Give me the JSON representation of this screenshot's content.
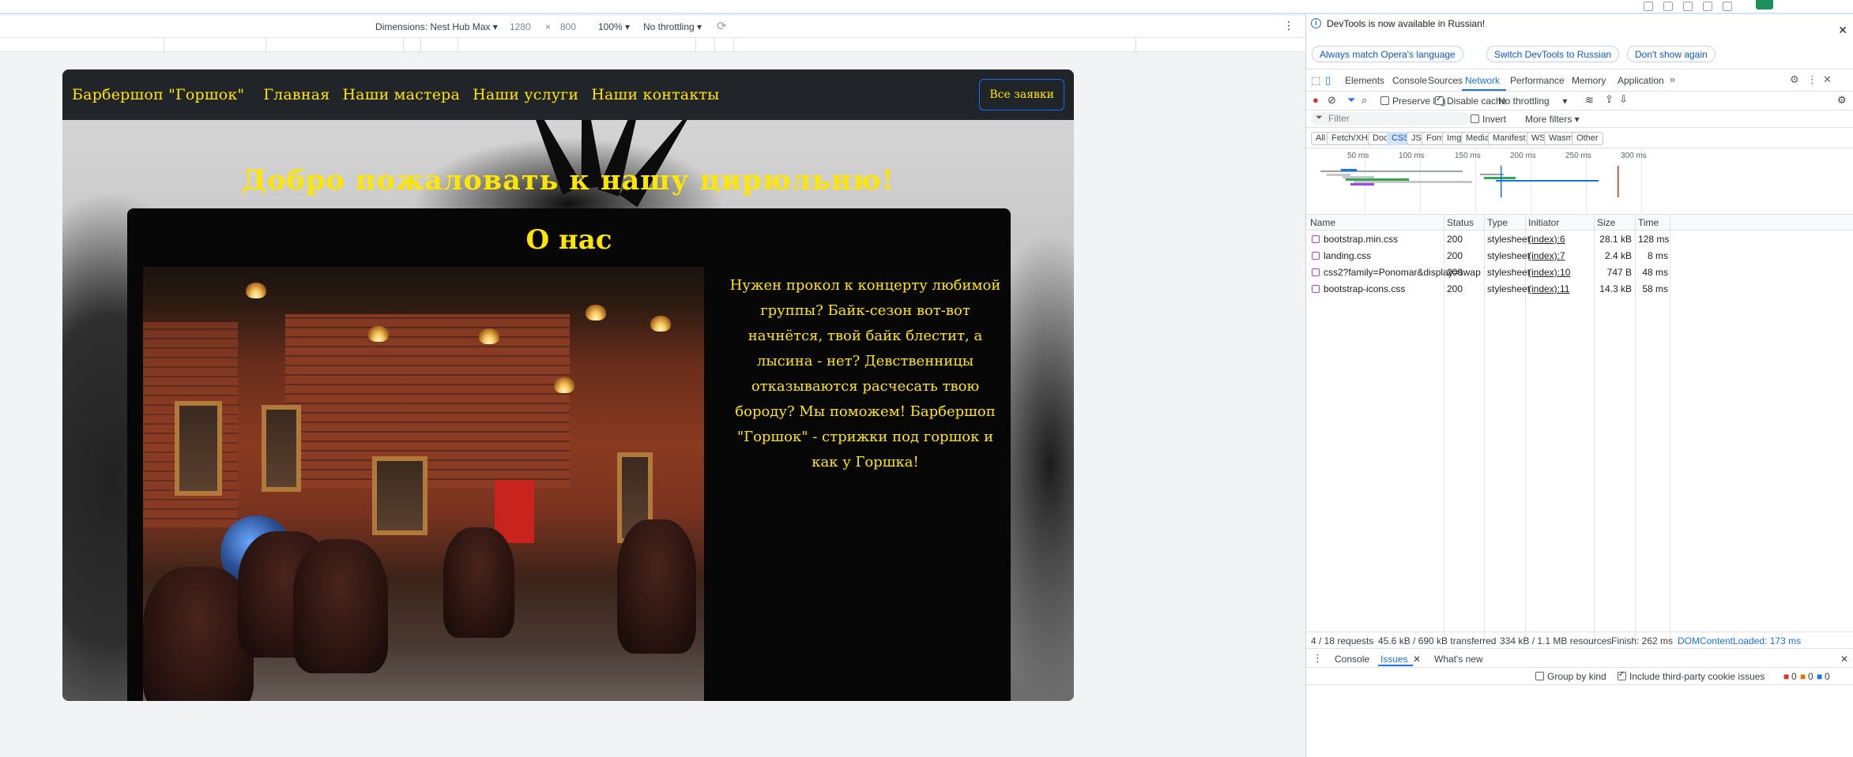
{
  "device_toolbar": {
    "dimensions_label": "Dimensions: Nest Hub Max",
    "width": "1280",
    "times": "×",
    "height": "800",
    "zoom": "100%",
    "throttling": "No throttling"
  },
  "site": {
    "nav": {
      "brand": "Барбершоп \"Горшок\"",
      "links": [
        "Главная",
        "Наши мастера",
        "Наши услуги",
        "Наши контакты"
      ],
      "button": "Все заявки"
    },
    "welcome": "Добро пожаловать к нашу цирюльню!",
    "about": {
      "title": "О нас",
      "text": "Нужен прокол к концерту любимой группы? Байк-сезон вот-вот начнётся, твой байк блестит, а лысина - нет? Девственницы отказываются расчесать твою бороду? Мы поможем! Барбершоп \"Горшок\" - стрижки под горшок и как у Горшка!"
    }
  },
  "devtools": {
    "info": {
      "message": "DevTools is now available in Russian!",
      "btn_match": "Always match Opera's language",
      "btn_switch": "Switch DevTools to Russian",
      "btn_dont_show": "Don't show again"
    },
    "tabs": [
      "Elements",
      "Console",
      "Sources",
      "Network",
      "Performance",
      "Memory",
      "Application"
    ],
    "active_tab": "Network",
    "toolbar": {
      "preserve_log": "Preserve log",
      "disable_cache": "Disable cache",
      "throttling": "No throttling"
    },
    "filter": {
      "placeholder": "Filter",
      "invert": "Invert",
      "more_filters": "More filters"
    },
    "type_chips": [
      "All",
      "Fetch/XHR",
      "Doc",
      "CSS",
      "JS",
      "Font",
      "Img",
      "Media",
      "Manifest",
      "WS",
      "Wasm",
      "Other"
    ],
    "active_chip": "CSS",
    "overview_ticks": [
      "50 ms",
      "100 ms",
      "150 ms",
      "200 ms",
      "250 ms",
      "300 ms"
    ],
    "table": {
      "headers": [
        "Name",
        "Status",
        "Type",
        "Initiator",
        "Size",
        "Time"
      ],
      "rows": [
        {
          "name": "bootstrap.min.css",
          "status": "200",
          "type": "stylesheet",
          "initiator": "(index):6",
          "size": "28.1 kB",
          "time": "128 ms"
        },
        {
          "name": "landing.css",
          "status": "200",
          "type": "stylesheet",
          "initiator": "(index):7",
          "size": "2.4 kB",
          "time": "8 ms"
        },
        {
          "name": "css2?family=Ponomar&display=swap",
          "status": "200",
          "type": "stylesheet",
          "initiator": "(index):10",
          "size": "747 B",
          "time": "48 ms"
        },
        {
          "name": "bootstrap-icons.css",
          "status": "200",
          "type": "stylesheet",
          "initiator": "(index):11",
          "size": "14.3 kB",
          "time": "58 ms"
        }
      ]
    },
    "summary": {
      "requests": "4 / 18 requests",
      "transferred": "45.6 kB / 690 kB transferred",
      "resources": "334 kB / 1.1 MB resources",
      "finish": "Finish: 262 ms",
      "dcl": "DOMContentLoaded: 173 ms"
    },
    "drawer": {
      "tabs": [
        "Console",
        "Issues",
        "What's new"
      ],
      "active": "Issues",
      "group_by_kind": "Group by kind",
      "include_third_party": "Include third-party cookie issues",
      "counts": [
        "0",
        "0",
        "0"
      ]
    }
  }
}
